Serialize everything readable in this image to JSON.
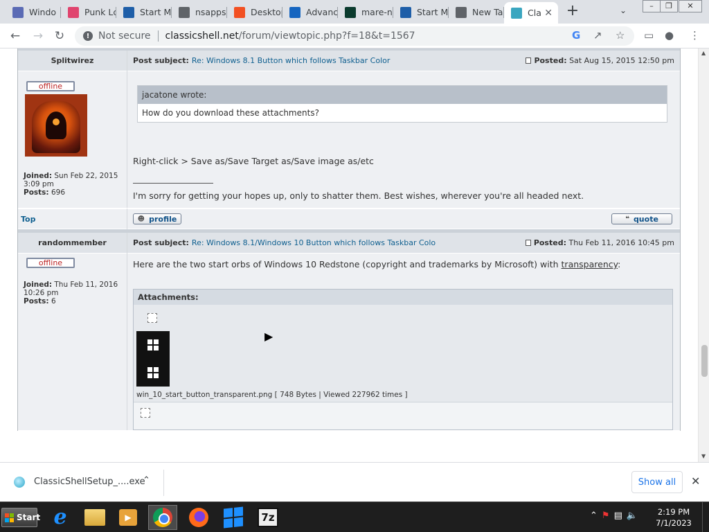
{
  "tabs": [
    {
      "title": "Windo",
      "icon": "tools-icon",
      "color": "#5b6bb5"
    },
    {
      "title": "Punk Lc",
      "icon": "punk-icon",
      "color": "#e0446e"
    },
    {
      "title": "Start M",
      "icon": "classicshell-icon",
      "color": "#1e5ea8"
    },
    {
      "title": "nsapps",
      "icon": "globe-icon",
      "color": "#5f6368"
    },
    {
      "title": "Desktop",
      "icon": "windows-icon",
      "color": "#f25022"
    },
    {
      "title": "Advanc",
      "icon": "code-icon",
      "color": "#1565c0"
    },
    {
      "title": "mare-n",
      "icon": "z-icon",
      "color": "#0b3b2e"
    },
    {
      "title": "Start M",
      "icon": "classicshell-icon",
      "color": "#1e5ea8"
    },
    {
      "title": "New Ta",
      "icon": "chrome-icon",
      "color": "#5f6368"
    },
    {
      "title": "Cla",
      "icon": "shell-icon",
      "color": "#3aa6c0",
      "active": true
    }
  ],
  "browser": {
    "security_label": "Not secure",
    "url_host": "classicshell.net",
    "url_path": "/forum/viewtopic.php?f=18&t=1567"
  },
  "post1": {
    "author": "Splitwirez",
    "status": "offline",
    "subject_label": "Post subject:",
    "subject": "Re: Windows 8.1 Button which follows Taskbar Color",
    "posted_label": "Posted:",
    "posted": "Sat Aug 15, 2015 12:50 pm",
    "joined_label": "Joined:",
    "joined": "Sun Feb 22, 2015",
    "joined_time": "3:09 pm",
    "posts_label": "Posts:",
    "posts": "696",
    "quote_author": "jacatone wrote:",
    "quote_text": "How do you download these attachments?",
    "reply": "Right-click > Save as/Save Target as/Save image as/etc",
    "signature_line": "_________________",
    "signature": "I'm sorry for getting your hopes up, only to shatter them. Best wishes, wherever you're all headed next."
  },
  "footer": {
    "top_link": "Top",
    "profile_btn": "profile",
    "quote_btn": "quote"
  },
  "post2": {
    "author": "randommember",
    "status": "offline",
    "subject_label": "Post subject:",
    "subject": "Re: Windows 8.1/Windows 10 Button which follows Taskbar Colo",
    "posted_label": "Posted:",
    "posted": "Thu Feb 11, 2016 10:45 pm",
    "joined_label": "Joined:",
    "joined": "Thu Feb 11, 2016",
    "joined_time": "10:26 pm",
    "posts_label": "Posts:",
    "posts": "6",
    "text_before": "Here are the two start orbs of Windows 10 Redstone (copyright and trademarks by Microsoft) with ",
    "link": "transparency",
    "text_after": ":",
    "attachments_label": "Attachments:",
    "attachment_caption": "win_10_start_button_transparent.png [ 748 Bytes | Viewed 227962 times ]"
  },
  "download": {
    "filename": "ClassicShellSetup_....exe",
    "show_all": "Show all"
  },
  "taskbar": {
    "start_label": "Start",
    "time": "2:19 PM",
    "date": "7/1/2023"
  }
}
